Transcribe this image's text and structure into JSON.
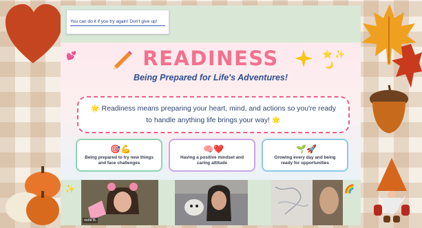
{
  "tip_text": "You can do it if you try again! Don't give up!",
  "title": "READINESS",
  "subtitle": "Being Prepared for Life's Adventures!",
  "definition": {
    "line1": "🌟 Readiness means preparing your heart, mind, and actions so you're ready",
    "line2": "to handle anything life brings your way! 🌟"
  },
  "cards": [
    {
      "emoji": "🎯💪",
      "line1": "Being prepared to try new things",
      "line2": "and face challenges"
    },
    {
      "emoji": "🧠❤️",
      "line1": "Having a positive mindset and",
      "line2": "caring attitude"
    },
    {
      "emoji": "🌱🚀",
      "line1": "Growing every day and being",
      "line2": "ready for opportunities"
    }
  ],
  "participants": [
    {
      "name": "rielle B."
    },
    {
      "name": ""
    },
    {
      "name": ""
    }
  ],
  "colors": {
    "title_pink": "#f2718f",
    "subtitle_blue": "#2f4e8d",
    "dashed_border": "#ea5c86",
    "card1_border": "#8ed2b4",
    "card2_border": "#c9a6e2",
    "card3_border": "#8cc8e4"
  }
}
